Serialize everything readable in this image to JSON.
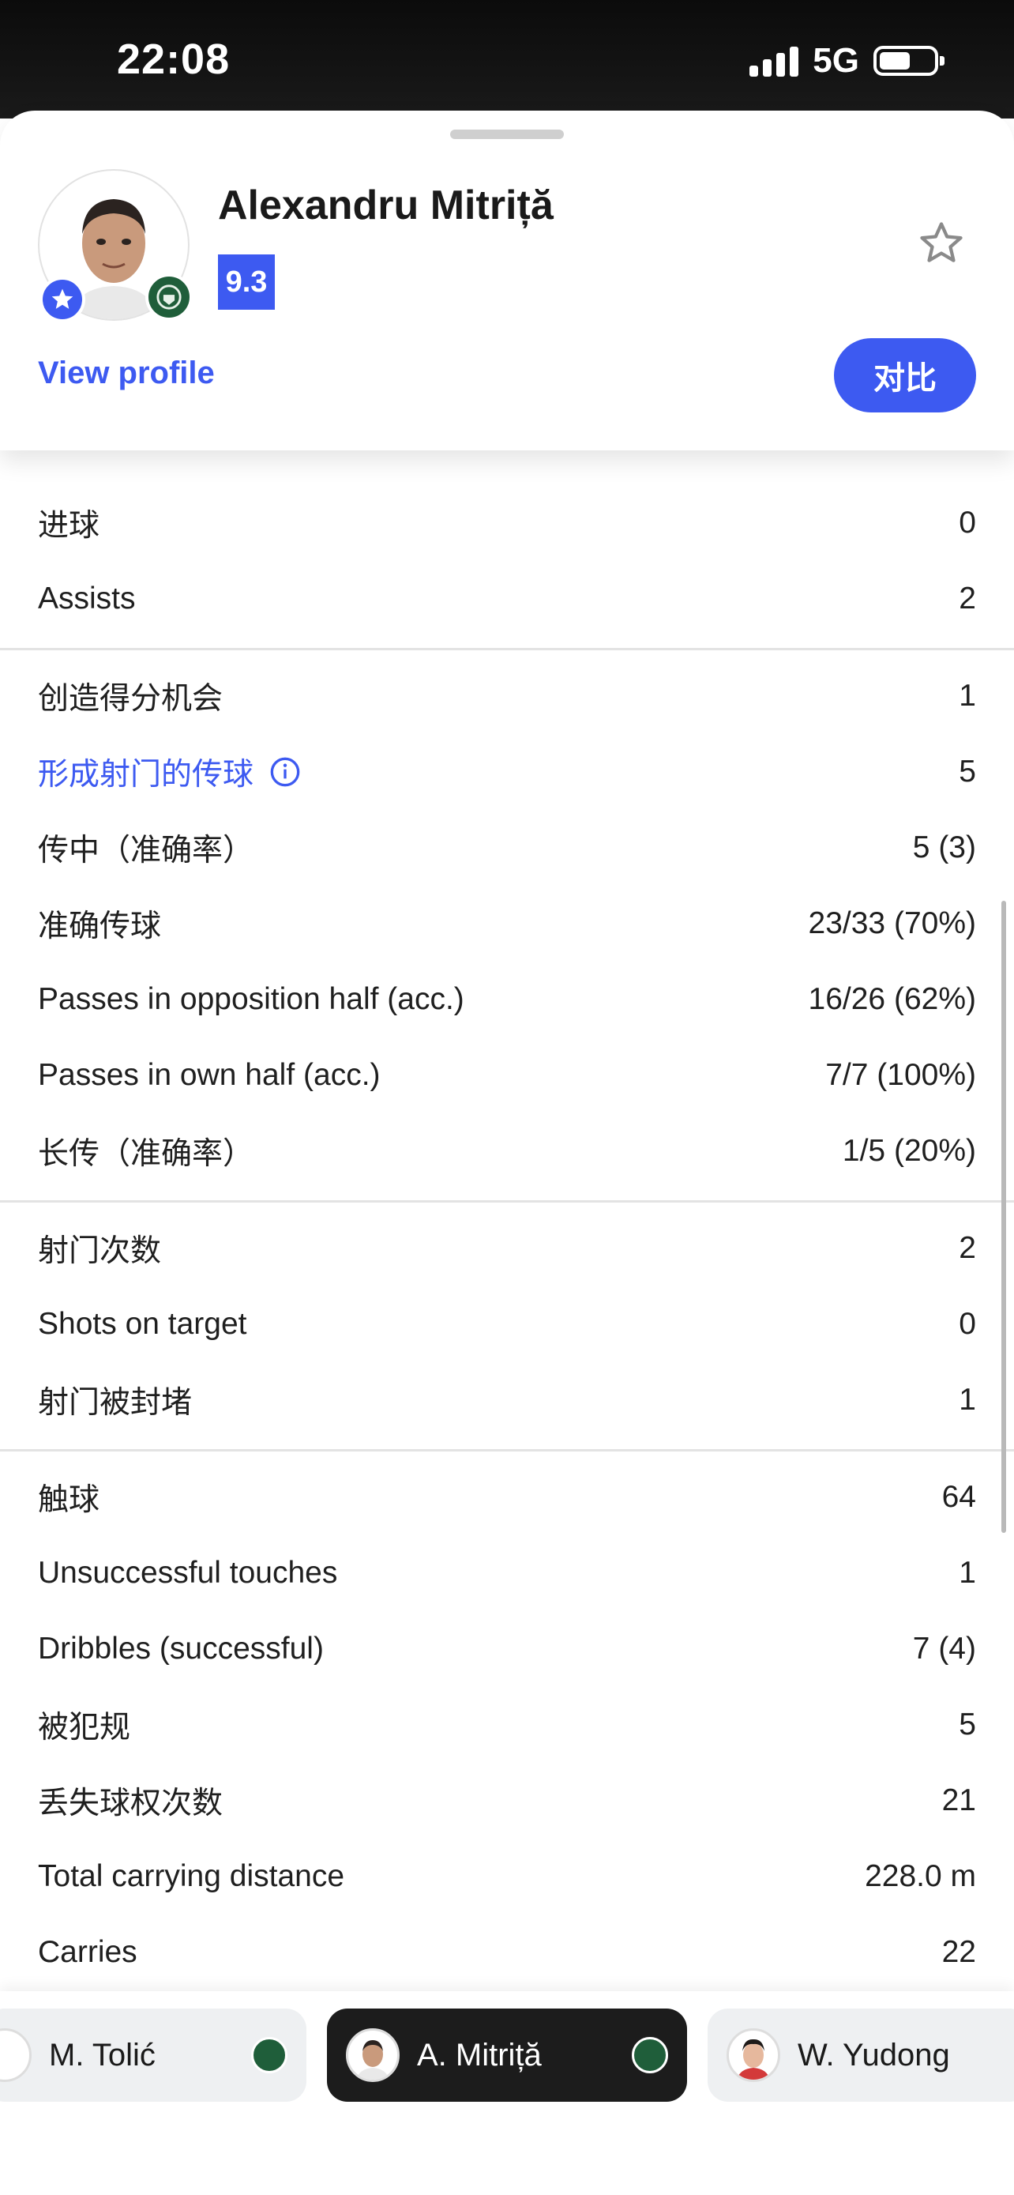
{
  "status_bar": {
    "time": "22:08",
    "network": "5G"
  },
  "player": {
    "name": "Alexandru Mitriță",
    "rating": "9.3",
    "view_profile": "View profile",
    "compare": "对比"
  },
  "stat_groups": [
    {
      "rows": [
        {
          "label": "进球",
          "value": "0"
        },
        {
          "label": "Assists",
          "value": "2"
        }
      ]
    },
    {
      "rows": [
        {
          "label": "创造得分机会",
          "value": "1"
        },
        {
          "label": "形成射门的传球",
          "value": "5",
          "link": true
        },
        {
          "label": "传中（准确率）",
          "value": "5 (3)"
        },
        {
          "label": "准确传球",
          "value": "23/33 (70%)"
        },
        {
          "label": "Passes in opposition half (acc.)",
          "value": "16/26 (62%)"
        },
        {
          "label": "Passes in own half (acc.)",
          "value": "7/7 (100%)"
        },
        {
          "label": "长传（准确率）",
          "value": "1/5 (20%)"
        }
      ]
    },
    {
      "rows": [
        {
          "label": "射门次数",
          "value": "2"
        },
        {
          "label": "Shots on target",
          "value": "0"
        },
        {
          "label": "射门被封堵",
          "value": "1"
        }
      ]
    },
    {
      "rows": [
        {
          "label": "触球",
          "value": "64"
        },
        {
          "label": "Unsuccessful touches",
          "value": "1"
        },
        {
          "label": "Dribbles (successful)",
          "value": "7 (4)"
        },
        {
          "label": "被犯规",
          "value": "5"
        },
        {
          "label": "丢失球权次数",
          "value": "21"
        },
        {
          "label": "Total carrying distance",
          "value": "228.0 m"
        },
        {
          "label": "Carries",
          "value": "22"
        }
      ]
    }
  ],
  "switcher": {
    "players": [
      {
        "name": "M. Tolić"
      },
      {
        "name": "A. Mitriță"
      },
      {
        "name": "W. Yudong"
      }
    ]
  }
}
